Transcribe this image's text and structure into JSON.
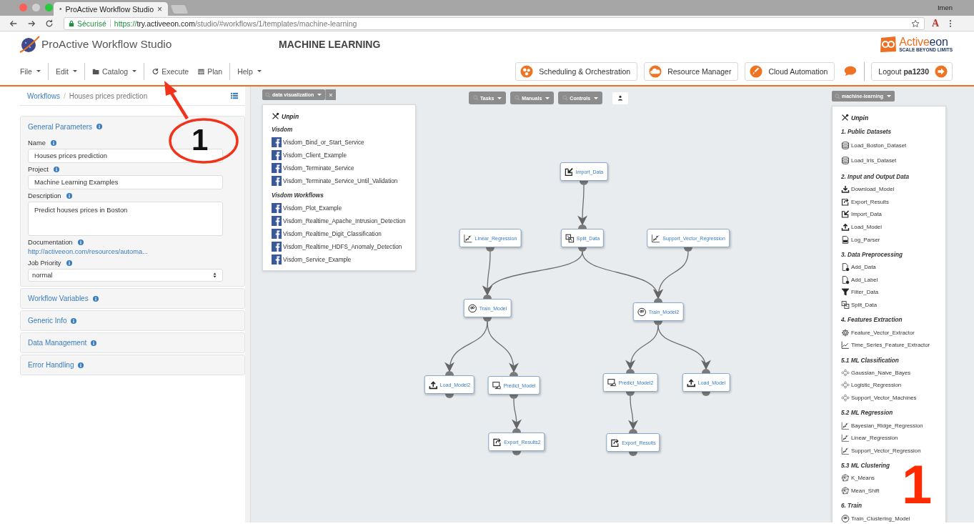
{
  "browser": {
    "tab_title": "ProActive Workflow Studio",
    "tab_close": "×",
    "secure_label": "Sécurisé",
    "url_scheme": "https://",
    "url_host": "try.activeeon.com",
    "url_path": "/studio/#workflows/1/templates/machine-learning",
    "extension": "A",
    "profile": "Imen"
  },
  "header": {
    "app_title": "ProActive Workflow Studio",
    "page_title": "MACHINE LEARNING",
    "brand": [
      "Active",
      "eon"
    ],
    "tagline": "SCALE BEYOND LIMITS"
  },
  "menu": [
    [
      {
        "label": "File",
        "kind": "plain",
        "dropdown": true
      }
    ],
    [
      {
        "label": "Edit",
        "kind": "plain",
        "dropdown": true
      }
    ],
    [
      {
        "label": "Catalog",
        "kind": "folder",
        "dropdown": true
      }
    ],
    [
      {
        "label": "Execute",
        "kind": "refresh",
        "dropdown": false
      },
      {
        "label": "Plan",
        "kind": "calendar",
        "dropdown": false
      }
    ],
    [
      {
        "label": "Help",
        "kind": "plain",
        "dropdown": true
      }
    ]
  ],
  "portals": [
    {
      "label": "Scheduling & Orchestration",
      "kind": "scheduling"
    },
    {
      "label": "Resource Manager",
      "kind": "resources"
    },
    {
      "label": "Cloud Automation",
      "kind": "automation"
    }
  ],
  "logout": {
    "label": "Logout",
    "user": "pa1230"
  },
  "breadcrumb": {
    "items": [
      "Workflows",
      "Houses prices prediction"
    ],
    "separator": "/"
  },
  "sections": [
    {
      "title": "General Parameters",
      "expanded": true,
      "fields": [
        {
          "label": "Name",
          "kind": "text",
          "value": "Houses prices prediction"
        },
        {
          "label": "Project",
          "kind": "text",
          "value": "Machine Learning Examples"
        },
        {
          "label": "Description",
          "kind": "textarea",
          "value": "Predict houses prices in Boston"
        },
        {
          "label": "Documentation",
          "kind": "link",
          "value": "http://activeeon.com/resources/automa..."
        },
        {
          "label": "Job Priority",
          "kind": "select",
          "value": "normal"
        }
      ]
    },
    {
      "title": "Workflow Variables",
      "expanded": false
    },
    {
      "title": "Generic Info",
      "expanded": false
    },
    {
      "title": "Data Management",
      "expanded": false
    },
    {
      "title": "Error Handling",
      "expanded": false
    }
  ],
  "left_palette": {
    "bucket": "data visualization",
    "close": "×",
    "unpin": "Unpin",
    "groups": [
      {
        "title": "Visdom",
        "items": [
          "Visdom_Bind_or_Start_Service",
          "Visdom_Client_Example",
          "Visdom_Terminate_Service",
          "Visdom_Terminate_Service_Until_Validation"
        ]
      },
      {
        "title": "Visdom Workflows",
        "items": [
          "Visdom_Plot_Example",
          "Visdom_Realtime_Apache_Intrusion_Detection",
          "Visdom_Realtime_Digit_Classification",
          "Visdom_Realtime_HDFS_Anomaly_Detection",
          "Visdom_Service_Example"
        ]
      }
    ]
  },
  "canvas_menus": [
    "Tasks",
    "Manuals",
    "Controls"
  ],
  "right_palette": {
    "bucket": "machine-learning",
    "unpin": "Unpin",
    "groups": [
      {
        "title": "1. Public Datasets",
        "items": [
          {
            "label": "Load_Boston_Dataset",
            "kind": "database"
          },
          {
            "label": "Load_Iris_Dataset",
            "kind": "database"
          }
        ]
      },
      {
        "title": "2. Input and Output Data",
        "items": [
          {
            "label": "Download_Model",
            "kind": "download"
          },
          {
            "label": "Export_Results",
            "kind": "export"
          },
          {
            "label": "Import_Data",
            "kind": "import"
          },
          {
            "label": "Load_Model",
            "kind": "upload"
          },
          {
            "label": "Log_Parser",
            "kind": "log"
          }
        ]
      },
      {
        "title": "3. Data Preprocessing",
        "items": [
          {
            "label": "Add_Data",
            "kind": "add"
          },
          {
            "label": "Add_Label",
            "kind": "add"
          },
          {
            "label": "Filter_Data",
            "kind": "filter"
          },
          {
            "label": "Split_Data",
            "kind": "split"
          }
        ]
      },
      {
        "title": "4. Features Extraction",
        "items": [
          {
            "label": "Feature_Vector_Extractor",
            "kind": "gear"
          },
          {
            "label": "Time_Series_Feature_Extractor",
            "kind": "timeseries"
          }
        ]
      },
      {
        "title": "5.1 ML Classification",
        "items": [
          {
            "label": "Gaussian_Naive_Bayes",
            "kind": "classifier"
          },
          {
            "label": "Logistic_Regression",
            "kind": "classifier"
          },
          {
            "label": "Support_Vector_Machines",
            "kind": "classifier"
          }
        ]
      },
      {
        "title": "5.2 ML Regression",
        "items": [
          {
            "label": "Bayesian_Ridge_Regression",
            "kind": "regression"
          },
          {
            "label": "Linear_Regression",
            "kind": "regression"
          },
          {
            "label": "Support_Vector_Regression",
            "kind": "regression"
          }
        ]
      },
      {
        "title": "5.3 ML Clustering",
        "items": [
          {
            "label": "K_Means",
            "kind": "cluster"
          },
          {
            "label": "Mean_Shift",
            "kind": "cluster"
          }
        ]
      },
      {
        "title": "6. Train",
        "items": [
          {
            "label": "Train_Clustering_Model",
            "kind": "train"
          }
        ]
      }
    ]
  },
  "workflow": {
    "nodes": [
      {
        "label": "Import_Data",
        "kind": "import"
      },
      {
        "label": "Linear_Regression",
        "kind": "regression"
      },
      {
        "label": "Split_Data",
        "kind": "split"
      },
      {
        "label": "Support_Vector_Regression",
        "kind": "regression"
      },
      {
        "label": "Train_Model",
        "kind": "train"
      },
      {
        "label": "Train_Model2",
        "kind": "train"
      },
      {
        "label": "Load_Model2",
        "kind": "upload"
      },
      {
        "label": "Predict_Model",
        "kind": "predict"
      },
      {
        "label": "Predict_Model2",
        "kind": "predict"
      },
      {
        "label": "Load_Model",
        "kind": "upload"
      },
      {
        "label": "Export_Results2",
        "kind": "export"
      },
      {
        "label": "Export_Results",
        "kind": "export"
      }
    ]
  },
  "annotations": {
    "circled_label": "1",
    "corner_label": "1"
  }
}
